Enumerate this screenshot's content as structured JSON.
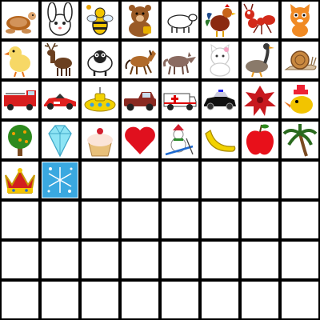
{
  "board": {
    "rows": 8,
    "cols": 8,
    "cells": [
      {
        "icon": "sea-turtle-icon"
      },
      {
        "icon": "white-bunny-icon"
      },
      {
        "icon": "bee-icon"
      },
      {
        "icon": "brown-bear-icon"
      },
      {
        "icon": "white-lamb-icon"
      },
      {
        "icon": "rooster-icon"
      },
      {
        "icon": "red-ant-icon"
      },
      {
        "icon": "orange-cat-icon"
      },
      {
        "icon": "yellow-chick-icon"
      },
      {
        "icon": "deer-icon"
      },
      {
        "icon": "black-sheep-icon"
      },
      {
        "icon": "brown-horse-icon"
      },
      {
        "icon": "wolf-icon"
      },
      {
        "icon": "white-kittens-icon"
      },
      {
        "icon": "goose-icon"
      },
      {
        "icon": "snail-icon"
      },
      {
        "icon": "fire-truck-icon"
      },
      {
        "icon": "race-car-icon"
      },
      {
        "icon": "yellow-submarine-icon"
      },
      {
        "icon": "pickup-truck-icon"
      },
      {
        "icon": "ambulance-icon"
      },
      {
        "icon": "police-car-icon"
      },
      {
        "icon": "red-leaf-bug-icon"
      },
      {
        "icon": "yellow-bird-hat-icon"
      },
      {
        "icon": "fruit-tree-icon"
      },
      {
        "icon": "diamond-icon"
      },
      {
        "icon": "cupcake-icon"
      },
      {
        "icon": "red-heart-icon"
      },
      {
        "icon": "snowman-skier-icon"
      },
      {
        "icon": "banana-icon"
      },
      {
        "icon": "red-apple-icon"
      },
      {
        "icon": "palm-tree-icon"
      },
      {
        "icon": "royal-crown-icon"
      },
      {
        "icon": "snowflake-tile-icon"
      }
    ]
  }
}
